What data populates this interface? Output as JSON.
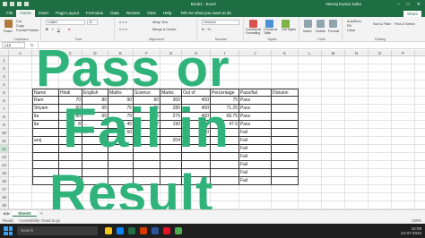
{
  "titlebar": {
    "doc_title": "Book1 - Excel",
    "user": "Neeraj Kumar Sahu",
    "minimize": "–",
    "maximize": "□",
    "close": "✕"
  },
  "tabs": [
    "File",
    "Home",
    "Insert",
    "Page Layout",
    "Formulas",
    "Data",
    "Review",
    "View",
    "Help"
  ],
  "tell_me": "Tell me what you want to do",
  "share": "Share",
  "ribbon": {
    "paste": "Paste",
    "cut": "Cut",
    "copy": "Copy",
    "format_painter": "Format Painter",
    "clipboard": "Clipboard",
    "font_name": "Calibri",
    "font_size": "11",
    "font_group": "Font",
    "wrap_text": "Wrap Text",
    "merge": "Merge & Center",
    "alignment": "Alignment",
    "number_format": "General",
    "number": "Number",
    "conditional": "Conditional Formatting",
    "format_table": "Format as Table",
    "cell_styles": "Cell Styles",
    "styles": "Styles",
    "insert": "Insert",
    "delete": "Delete",
    "format": "Format",
    "cells": "Cells",
    "autosum": "AutoSum",
    "fill": "Fill",
    "clear": "Clear",
    "sort": "Sort & Filter",
    "find": "Find & Select",
    "editing": "Editing"
  },
  "formula_bar": {
    "name_box": "L12",
    "fx": "fx",
    "value": ""
  },
  "columns": [
    "A",
    "B",
    "C",
    "D",
    "E",
    "F",
    "G",
    "H",
    "I",
    "J",
    "K",
    "L",
    "M",
    "N",
    "O",
    "P",
    "Q",
    "R"
  ],
  "rows": [
    "1",
    "2",
    "3",
    "4",
    "5",
    "6",
    "7",
    "8",
    "9",
    "10",
    "11",
    "12",
    "13",
    "14",
    "15",
    "16",
    "17",
    "18",
    "19"
  ],
  "table": {
    "headers": [
      "Name",
      "Hindi",
      "English",
      "Maths",
      "Science",
      "Marks",
      "Out of",
      "Percentage",
      "Pass/fail",
      "Division"
    ],
    "rows": [
      [
        "Ram",
        "70",
        "80",
        "90",
        "60",
        "300",
        "400",
        "75",
        "Pass",
        ""
      ],
      [
        "Shyam",
        "60",
        "65",
        "75",
        "85",
        "285",
        "400",
        "71.25",
        "Pass",
        ""
      ],
      [
        "ita",
        "80",
        "65",
        "75",
        "55",
        "275",
        "400",
        "68.75",
        "Pass",
        ""
      ],
      [
        "ita",
        "8",
        "...",
        "45",
        "87",
        "190",
        "400",
        "47.5",
        "Pass",
        ""
      ],
      [
        "",
        "4",
        "...",
        "60",
        "",
        "",
        "400",
        "",
        "Fail",
        ""
      ],
      [
        "aroj",
        "",
        "",
        "",
        "",
        "204",
        "",
        "",
        "Fail",
        ""
      ],
      [
        "",
        "",
        "",
        "",
        "",
        "",
        "",
        "",
        "Fail",
        ""
      ],
      [
        "",
        "",
        "",
        "",
        "",
        "",
        "",
        "",
        "Fail",
        ""
      ],
      [
        "",
        "",
        "",
        "",
        "",
        "",
        "",
        "",
        "Fail",
        ""
      ],
      [
        "",
        "",
        "",
        "",
        "",
        "",
        "",
        "",
        "Fail",
        ""
      ],
      [
        "",
        "",
        "",
        "",
        "",
        "",
        "",
        "",
        "Fail",
        ""
      ]
    ]
  },
  "overlay": {
    "line1": "Pass or",
    "line2": "Fail in",
    "line3": "Result"
  },
  "sheet_tab": "Sheet1",
  "add_sheet": "+",
  "status": {
    "ready": "Ready",
    "accessibility": "Accessibility: Good to go",
    "zoom": "100%"
  },
  "taskbar": {
    "search": "Search",
    "time": "22:09",
    "date": "22-07-2023"
  },
  "colors": {
    "excel_green": "#1f6e43",
    "overlay_green": "#2fb37a"
  }
}
